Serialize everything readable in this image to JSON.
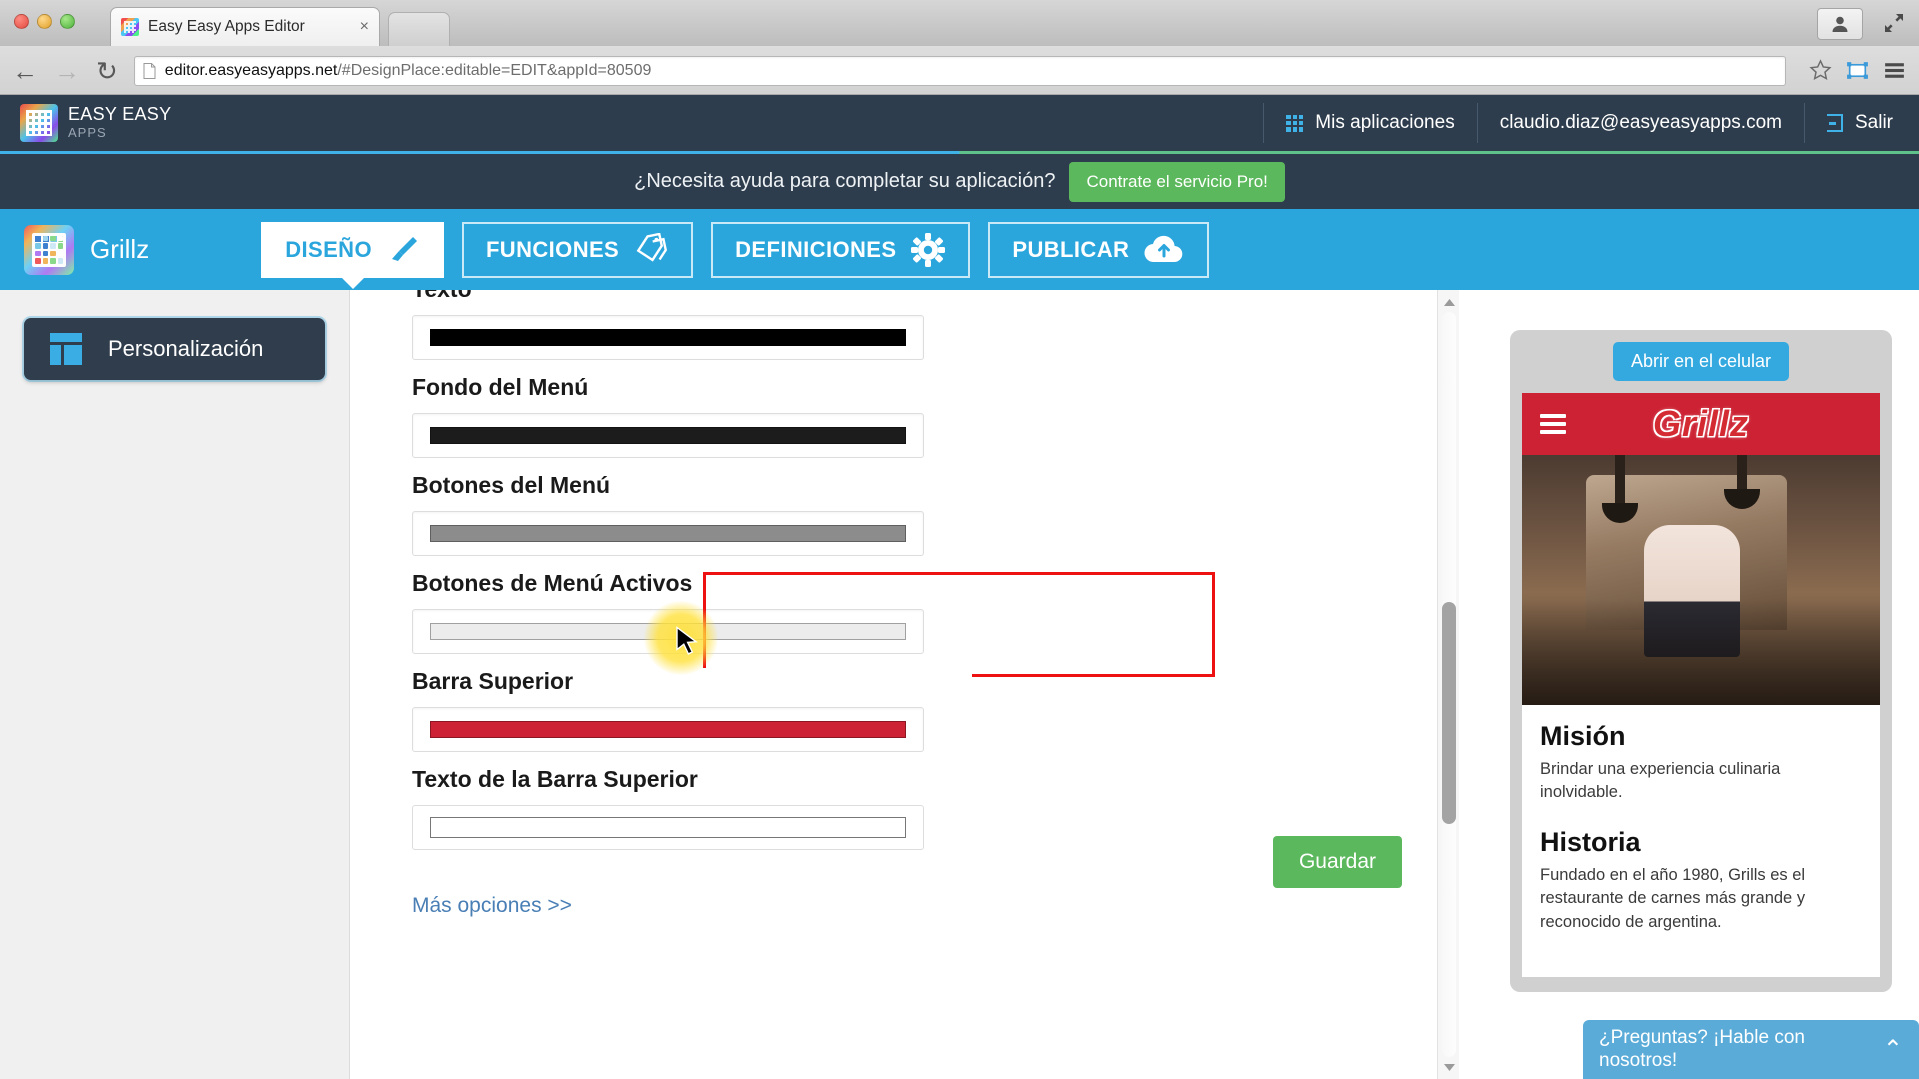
{
  "browser": {
    "tab_title": "Easy Easy Apps Editor",
    "tab_close": "×",
    "back_glyph": "←",
    "forward_glyph": "→",
    "reload_glyph": "↻",
    "url_host": "editor.easyeasyapps.net",
    "url_path": "/#DesignPlace:editable=EDIT&appId=80509"
  },
  "header": {
    "brand_top": "EASY EASY",
    "brand_sub": "APPS",
    "apps_label": "Mis aplicaciones",
    "account_email": "claudio.diaz@easyeasyapps.com",
    "logout_label": "Salir"
  },
  "promo": {
    "text": "¿Necesita ayuda para completar su aplicación?",
    "button_label": "Contrate el servicio Pro!"
  },
  "apptabs": {
    "app_name": "Grillz",
    "items": [
      {
        "label": "DISEÑO",
        "icon": "paintbrush-icon",
        "active": true
      },
      {
        "label": "FUNCIONES",
        "icon": "tags-icon",
        "active": false
      },
      {
        "label": "DEFINICIONES",
        "icon": "gear-icon",
        "active": false
      },
      {
        "label": "PUBLICAR",
        "icon": "cloud-upload-icon",
        "active": false
      }
    ]
  },
  "sidebar": {
    "items": [
      {
        "label": "Personalización",
        "icon": "layout-icon",
        "active": true
      }
    ]
  },
  "form": {
    "fields": [
      {
        "label": "Texto",
        "type": "color",
        "value": "#000000",
        "highlighted": false
      },
      {
        "label": "Fondo del Menú",
        "type": "color",
        "value": "#1c1c1c",
        "highlighted": false
      },
      {
        "label": "Botones del Menú",
        "type": "color",
        "value": "#8c8c8c",
        "highlighted": false
      },
      {
        "label": "Botones de Menú Activos",
        "type": "color",
        "value": "#ececec",
        "highlighted": false
      },
      {
        "label": "Barra Superior",
        "type": "color",
        "value": "#cc2233",
        "highlighted": true
      },
      {
        "label": "Texto de la Barra Superior",
        "type": "text",
        "value": "",
        "highlighted": false
      }
    ],
    "more_options_label": "Más opciones >>",
    "save_label": "Guardar",
    "highlight_color": "#ee1111"
  },
  "preview": {
    "open_mobile_label": "Abrir en el celular",
    "app_logo": "Grillz",
    "topbar_color": "#cc2233",
    "sections": [
      {
        "heading": "Misión",
        "body": "Brindar una experiencia culinaria inolvidable."
      },
      {
        "heading": "Historia",
        "body": "Fundado en el año 1980, Grills es el restaurante de carnes más grande y reconocido de argentina."
      }
    ]
  },
  "chat": {
    "text": "¿Preguntas? ¡Hable con nosotros!",
    "caret": "⌃"
  },
  "colors": {
    "header_bg": "#2e3d4d",
    "accent_blue": "#2aa6dd",
    "green": "#5cb85c",
    "red_highlight": "#ee1111"
  }
}
